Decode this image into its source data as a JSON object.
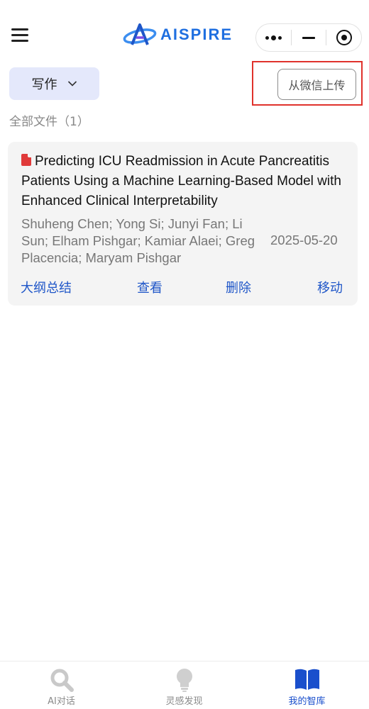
{
  "header": {
    "brand": "AISPIRE",
    "menu_icon": "hamburger-icon",
    "capsule_icons": [
      "more-dots-icon",
      "minimize-icon",
      "target-icon"
    ]
  },
  "toolbar": {
    "write_label": "写作",
    "upload_label": "从微信上传",
    "highlight_color": "#e0322c"
  },
  "files": {
    "count_label": "全部文件（1）",
    "items": [
      {
        "title": "Predicting ICU Readmission in Acute Pancreatitis Patients Using a Machine Learning-Based Model with Enhanced Clinical Interpretability",
        "authors": "Shuheng Chen; Yong Si; Junyi Fan; Li Sun; Elham Pishgar; Kamiar Alaei; Greg Placencia; Maryam Pishgar",
        "date": "2025-05-20",
        "actions": {
          "summary": "大纲总结",
          "view": "查看",
          "delete": "删除",
          "move": "移动"
        }
      }
    ]
  },
  "tabbar": {
    "tabs": [
      {
        "label": "AI对话",
        "icon": "search-icon"
      },
      {
        "label": "灵感发现",
        "icon": "lightbulb-icon"
      },
      {
        "label": "我的智库",
        "icon": "book-icon"
      }
    ],
    "active_color": "#1a4fcc"
  },
  "colors": {
    "accent": "#1f56c8",
    "write_button_bg": "#e4e8fb",
    "card_bg": "#f4f4f4"
  }
}
